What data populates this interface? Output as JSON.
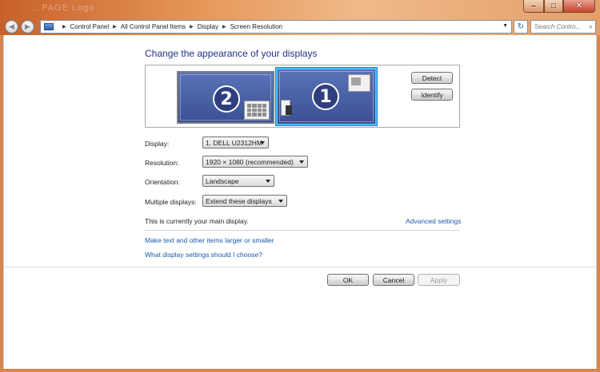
{
  "window": {
    "title_ghost": "...PAGE Logo",
    "buttons": {
      "minimize": "–",
      "maximize": "□",
      "close": "✕"
    }
  },
  "address_bar": {
    "breadcrumbs": [
      "Control Panel",
      "All Control Panel Items",
      "Display",
      "Screen Resolution"
    ],
    "search_placeholder": "Search Contro..."
  },
  "main": {
    "heading": "Change the appearance of your displays",
    "monitors": [
      {
        "number": "2",
        "active": false
      },
      {
        "number": "1",
        "active": true
      }
    ],
    "buttons": {
      "detect": "Detect",
      "identify": "Identify"
    },
    "settings": [
      {
        "label": "Display:",
        "value": "1. DELL U2312HM"
      },
      {
        "label": "Resolution:",
        "value": "1920 × 1080 (recommended)"
      },
      {
        "label": "Orientation:",
        "value": "Landscape"
      },
      {
        "label": "Multiple displays:",
        "value": "Extend these displays"
      }
    ],
    "main_display_text": "This is currently your main display.",
    "advanced_link": "Advanced settings",
    "links": [
      "Make text and other items larger or smaller",
      "What display settings should I choose?"
    ]
  },
  "footer": {
    "ok": "OK",
    "cancel": "Cancel",
    "apply": "Apply"
  },
  "colors": {
    "heading": "#1e3287",
    "link": "#1a5aa8",
    "monitor_fill": "#4a61a6",
    "selected_border": "#4cc2ff",
    "frame": "#e79a5c"
  }
}
